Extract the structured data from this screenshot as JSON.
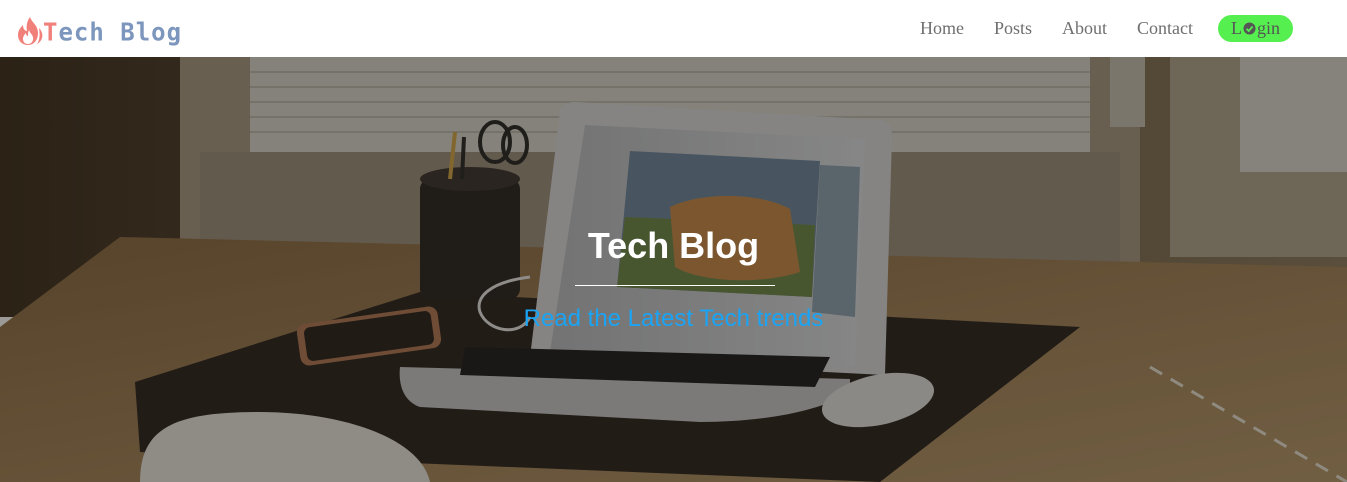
{
  "brand": {
    "logo_icon": "flame-icon",
    "name_first_letter": "T",
    "name_rest": "ech Blog",
    "colors": {
      "flame": "#f2807a",
      "text": "#7d96bd"
    }
  },
  "nav": {
    "items": [
      {
        "label": "Home"
      },
      {
        "label": "Posts"
      },
      {
        "label": "About"
      },
      {
        "label": "Contact"
      }
    ],
    "login": {
      "label_before": "L",
      "icon": "checkmark-circle-icon",
      "label_after": "gin",
      "color": "#55ef4f"
    }
  },
  "hero": {
    "background": "desk-with-laptop-photo",
    "title": "Tech Blog",
    "subtitle": "Read the Latest Tech trends",
    "subtitle_color": "#1aa4f5"
  }
}
